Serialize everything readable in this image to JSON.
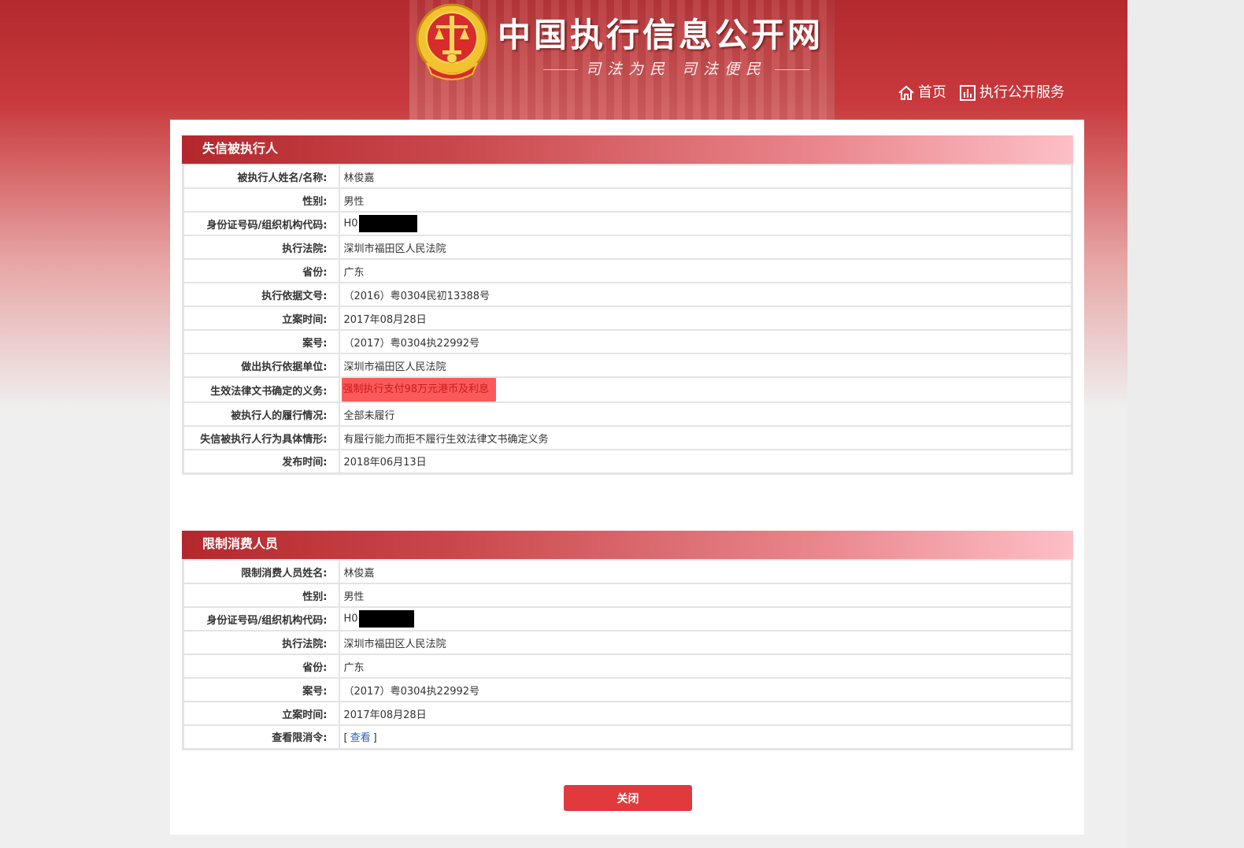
{
  "header": {
    "site_title": "中国执行信息公开网",
    "slogan": "司法为民   司法便民",
    "nav": [
      {
        "label": "首页",
        "icon": "home-icon"
      },
      {
        "label": "执行公开服务",
        "icon": "bar-chart-icon"
      }
    ]
  },
  "dishonest": {
    "title": "失信被执行人",
    "rows": [
      {
        "label": "被执行人姓名/名称:",
        "value": "林俊嘉"
      },
      {
        "label": "性别:",
        "value": "男性"
      },
      {
        "label": "身份证号码/组织机构代码:",
        "value": "H0"
      },
      {
        "label": "执行法院:",
        "value": "深圳市福田区人民法院"
      },
      {
        "label": "省份:",
        "value": "广东"
      },
      {
        "label": "执行依据文号:",
        "value": "（2016）粤0304民初13388号"
      },
      {
        "label": "立案时间:",
        "value": "2017年08月28日"
      },
      {
        "label": "案号:",
        "value": "（2017）粤0304执22992号"
      },
      {
        "label": "做出执行依据单位:",
        "value": "深圳市福田区人民法院"
      },
      {
        "label": "生效法律文书确定的义务:",
        "value": "强制执行支付98万元港币及利息"
      },
      {
        "label": "被执行人的履行情况:",
        "value": "全部未履行"
      },
      {
        "label": "失信被执行人行为具体情形:",
        "value": "有履行能力而拒不履行生效法律文书确定义务"
      },
      {
        "label": "发布时间:",
        "value": "2018年06月13日"
      }
    ]
  },
  "restricted": {
    "title": "限制消费人员",
    "rows": [
      {
        "label": "限制消费人员姓名:",
        "value": "林俊嘉"
      },
      {
        "label": "性别:",
        "value": "男性"
      },
      {
        "label": "身份证号码/组织机构代码:",
        "value": "H0"
      },
      {
        "label": "执行法院:",
        "value": "深圳市福田区人民法院"
      },
      {
        "label": "省份:",
        "value": "广东"
      },
      {
        "label": "案号:",
        "value": "（2017）粤0304执22992号"
      },
      {
        "label": "立案时间:",
        "value": "2017年08月28日"
      },
      {
        "label": "查看限消令:",
        "bracket_open": "[",
        "link": "查看",
        "bracket_close": "]"
      }
    ]
  },
  "close_button": "关闭",
  "colors": {
    "brand_red": "#b32a2e",
    "highlight": "#fb5a5a",
    "link": "#2a63b8",
    "button": "#e03a3e"
  }
}
